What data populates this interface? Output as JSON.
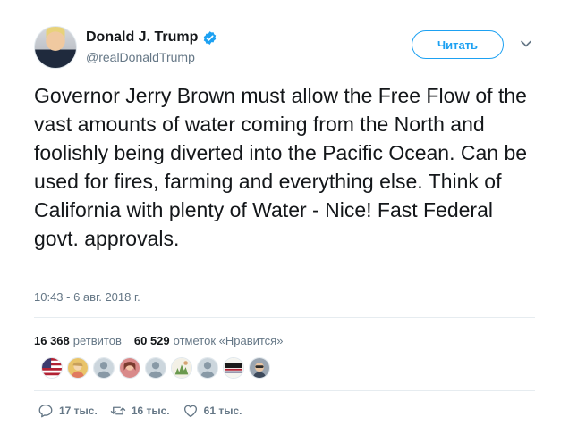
{
  "tweet": {
    "author": {
      "display_name": "Donald J. Trump",
      "handle": "@realDonaldTrump",
      "verified": true
    },
    "follow_button_label": "Читать",
    "text": "Governor Jerry Brown must allow the Free Flow of the vast amounts of water coming from the North and foolishly being diverted into the Pacific Ocean. Can be used for fires, farming and everything else. Think of California with plenty of Water - Nice! Fast Federal govt. approvals.",
    "timestamp": "10:43 - 6 авг. 2018 г.",
    "stats": {
      "retweets_count": "16 368",
      "retweets_label": "ретвитов",
      "likes_count": "60 529",
      "likes_label": "отметок «Нравится»"
    },
    "actions": {
      "reply_count": "17 тыс.",
      "retweet_count": "16 тыс.",
      "like_count": "61 тыс."
    }
  },
  "colors": {
    "accent": "#1da1f2",
    "text": "#14171a",
    "secondary": "#657786",
    "divider": "#e6ecf0"
  },
  "icons": [
    "verified-badge-icon",
    "chevron-down-icon",
    "reply-icon",
    "retweet-icon",
    "heart-icon"
  ]
}
